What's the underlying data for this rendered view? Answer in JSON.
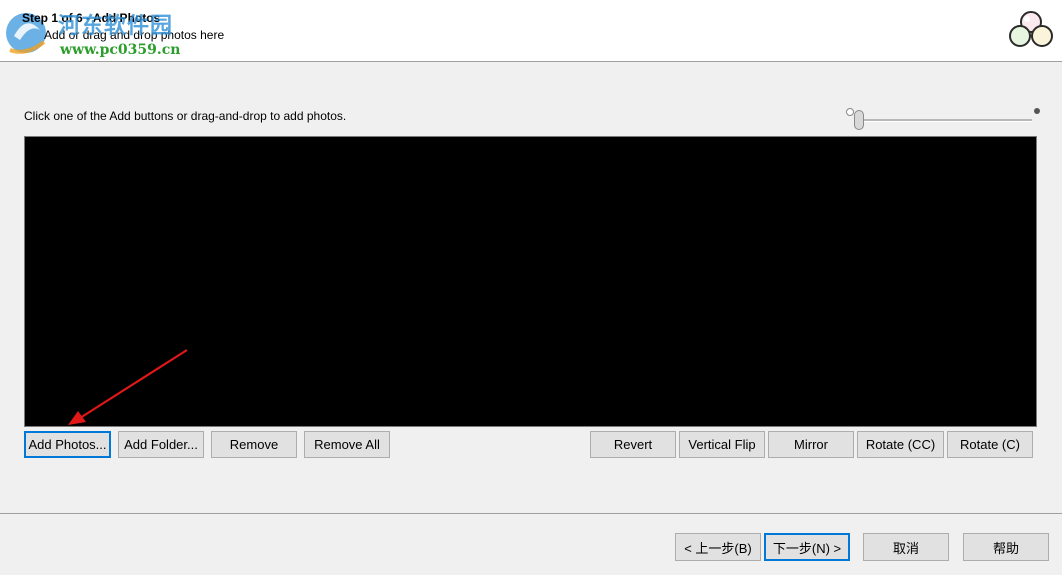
{
  "header": {
    "step_title": "Step 1 of 6 - Add Photos",
    "step_subtitle": "Add or drag and drop photos here",
    "watermark_cn": "河东软件园",
    "watermark_url": "www.pc0359.cn"
  },
  "instruction": "Click one of the Add buttons or drag-and-drop to add photos.",
  "thumbnail_size_slider": {
    "value": 0
  },
  "photo_buttons": {
    "add_photos": "Add Photos...",
    "add_folder": "Add Folder...",
    "remove": "Remove",
    "remove_all": "Remove All",
    "revert": "Revert",
    "vertical_flip": "Vertical Flip",
    "mirror": "Mirror",
    "rotate_cc": "Rotate (CC)",
    "rotate_c": "Rotate (C)"
  },
  "wizard_buttons": {
    "back": "< 上一步(B)",
    "next": "下一步(N) >",
    "cancel": "取消",
    "help": "帮助"
  },
  "colors": {
    "focus_border": "#0078d7",
    "annotation_arrow": "#e01818",
    "photo_area_bg": "#000000"
  }
}
